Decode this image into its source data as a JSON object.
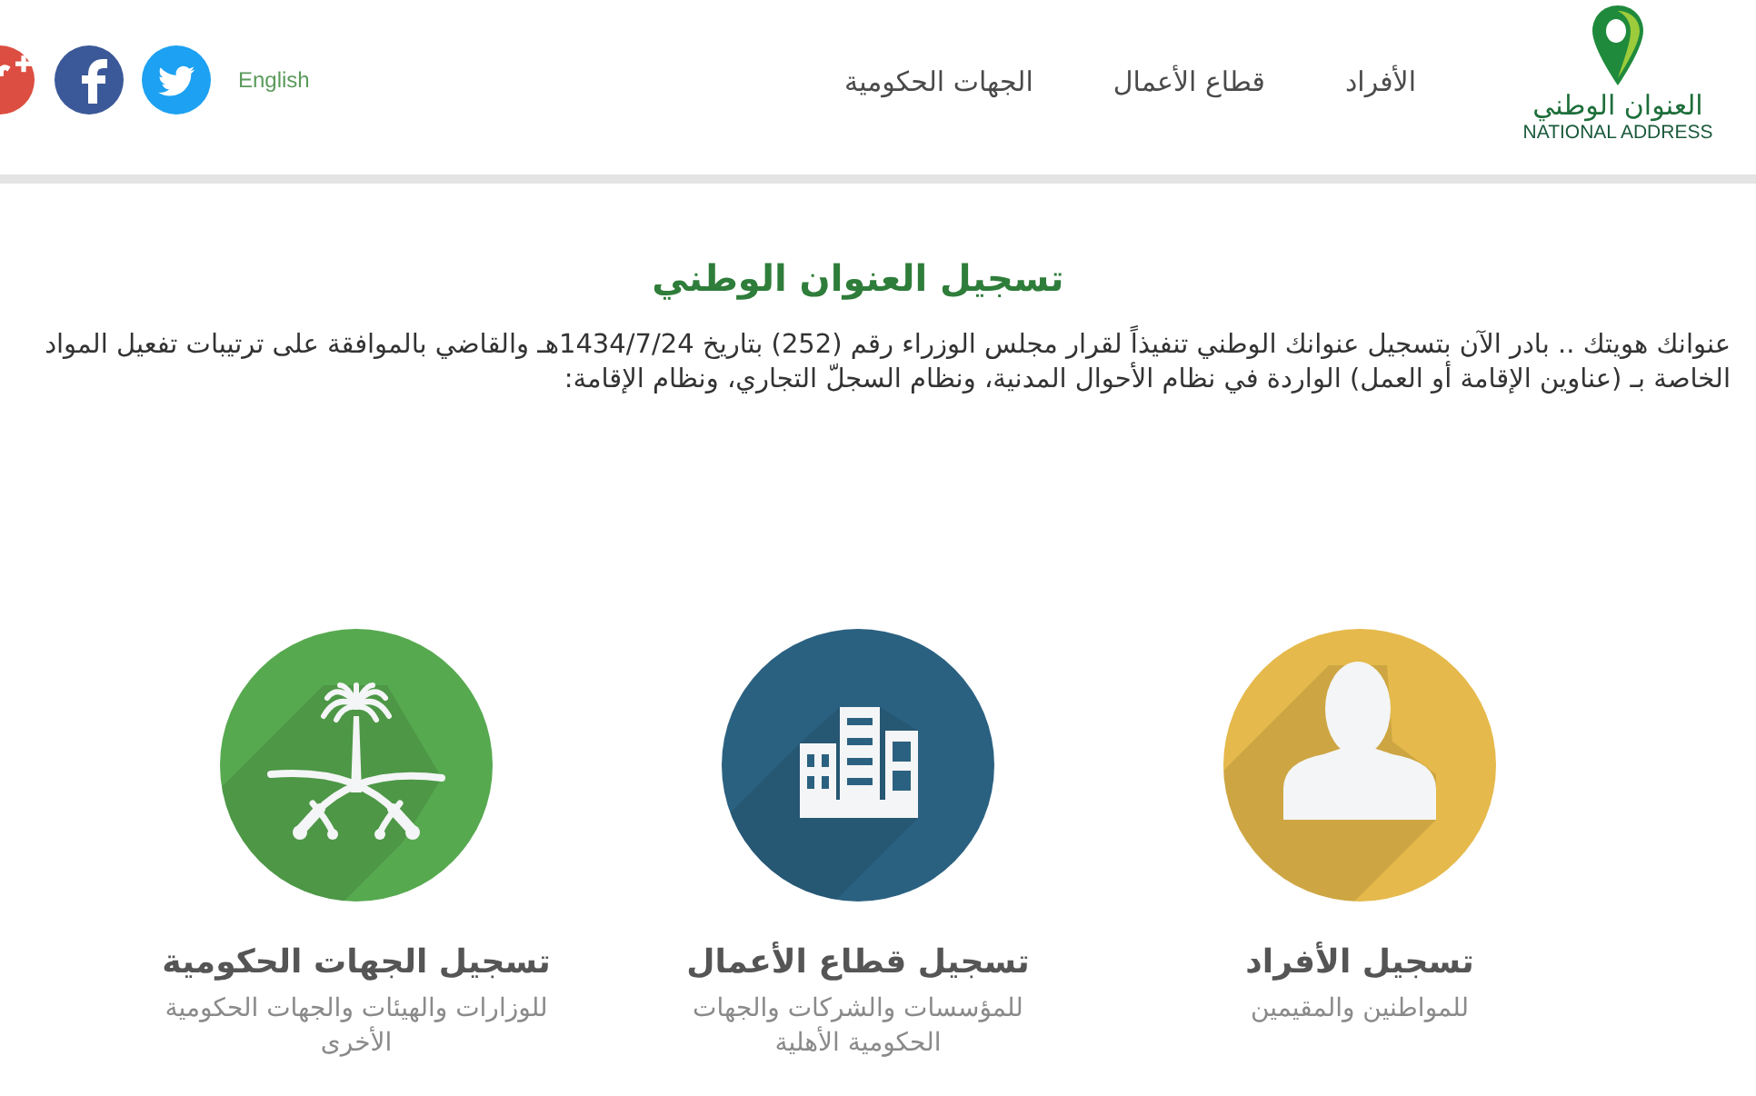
{
  "header": {
    "logo": {
      "arabic": "العنوان الوطني",
      "english": "NATIONAL ADDRESS"
    },
    "nav": [
      "الأفراد",
      "قطاع الأعمال",
      "الجهات الحكومية"
    ],
    "language_link": "English"
  },
  "main": {
    "title": "تسجيل العنوان الوطني",
    "intro": "عنوانك هويتك .. بادر الآن بتسجيل عنوانك الوطني تنفيذاً لقرار مجلس الوزراء رقم (252) بتاريخ 1434/7/24هـ والقاضي بالموافقة على ترتيبات تفعيل المواد الخاصة بـ (عناوين الإقامة أو العمل) الواردة في نظام الأحوال المدنية، ونظام السجلّ التجاري، ونظام الإقامة:"
  },
  "cards": [
    {
      "title": "تسجيل الأفراد",
      "subtitle": "للمواطنين والمقيمين",
      "color": "#e5b94b"
    },
    {
      "title": "تسجيل قطاع الأعمال",
      "subtitle": "للمؤسسات والشركات والجهات الحكومية الأهلية",
      "color": "#2b6180"
    },
    {
      "title": "تسجيل الجهات الحكومية",
      "subtitle": "للوزارات والهيئات والجهات الحكومية الأخرى",
      "color": "#56a94f"
    }
  ]
}
